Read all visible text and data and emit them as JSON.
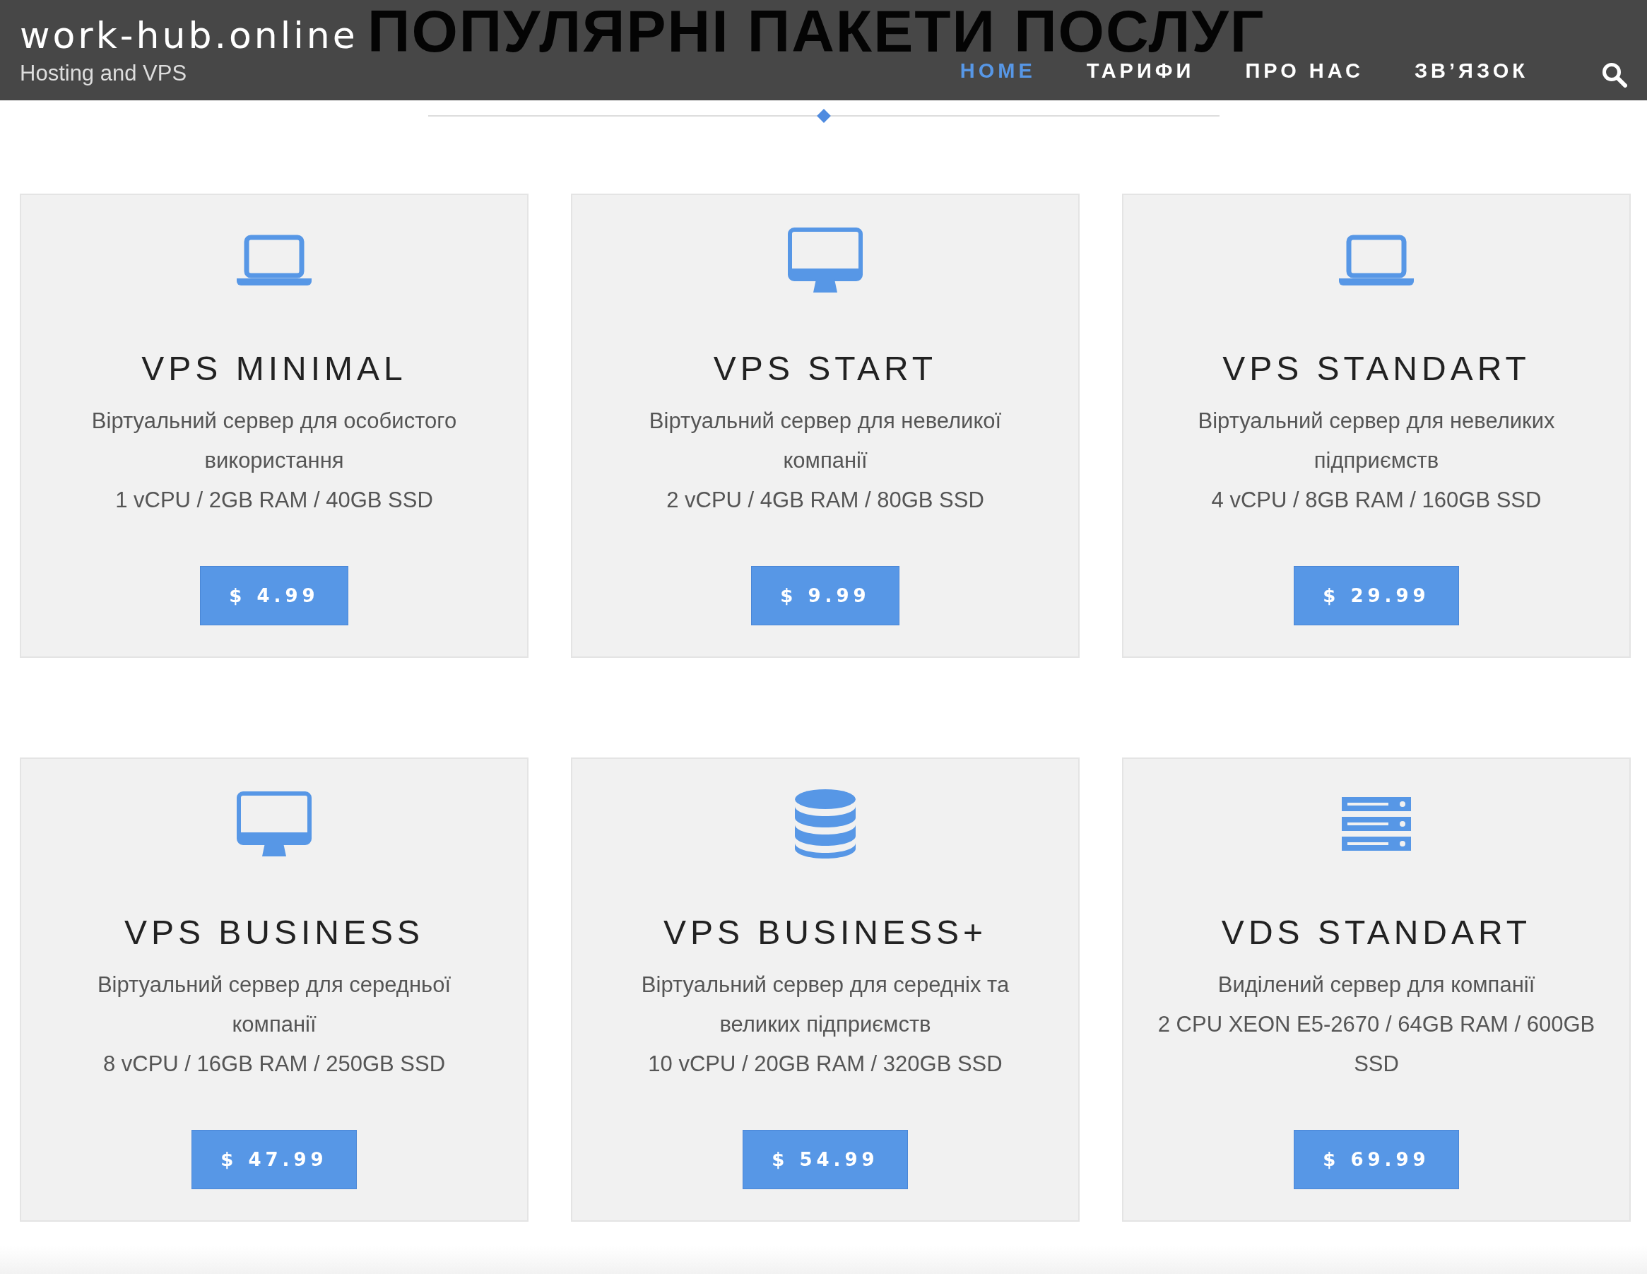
{
  "section_title": "ПОПУЛЯРНІ ПАКЕТИ ПОСЛУГ",
  "header": {
    "site_name": "work-hub.online",
    "tagline": "Hosting and VPS"
  },
  "nav": [
    {
      "label": "HOME",
      "selected": true
    },
    {
      "label": "ТАРИФИ",
      "selected": false
    },
    {
      "label": "ПРО НАС",
      "selected": false
    },
    {
      "label": "ЗВ’ЯЗОК",
      "selected": false
    }
  ],
  "plans": [
    {
      "kind": "laptop",
      "title": "VPS MINIMAL",
      "description": "Віртуальний сервер для особистого використання",
      "specs": "1 vCPU / 2GB RAM / 40GB SSD",
      "price": "$ 4.99"
    },
    {
      "kind": "desktop",
      "title": "VPS START",
      "description": "Віртуальний сервер для невеликої компанії",
      "specs": "2 vCPU / 4GB RAM / 80GB SSD",
      "price": "$ 9.99"
    },
    {
      "kind": "laptop",
      "title": "VPS STANDART",
      "description": "Віртуальний сервер для невеликих підприємств",
      "specs": "4 vCPU / 8GB RAM / 160GB SSD",
      "price": "$ 29.99"
    },
    {
      "kind": "desktop",
      "title": "VPS BUSINESS",
      "description": "Віртуальний сервер для середньої компанії",
      "specs": "8 vCPU / 16GB RAM / 250GB SSD",
      "price": "$ 47.99"
    },
    {
      "kind": "database",
      "title": "VPS BUSINESS+",
      "description": "Віртуальний сервер для середніх та великих підприємств",
      "specs": "10 vCPU / 20GB RAM / 320GB SSD",
      "price": "$ 54.99"
    },
    {
      "kind": "server",
      "title": "VDS STANDART",
      "description": "Виділений сервер для компанії",
      "specs": "2 CPU XEON E5-2670 / 64GB RAM / 600GB SSD",
      "price": "$ 69.99"
    }
  ]
}
